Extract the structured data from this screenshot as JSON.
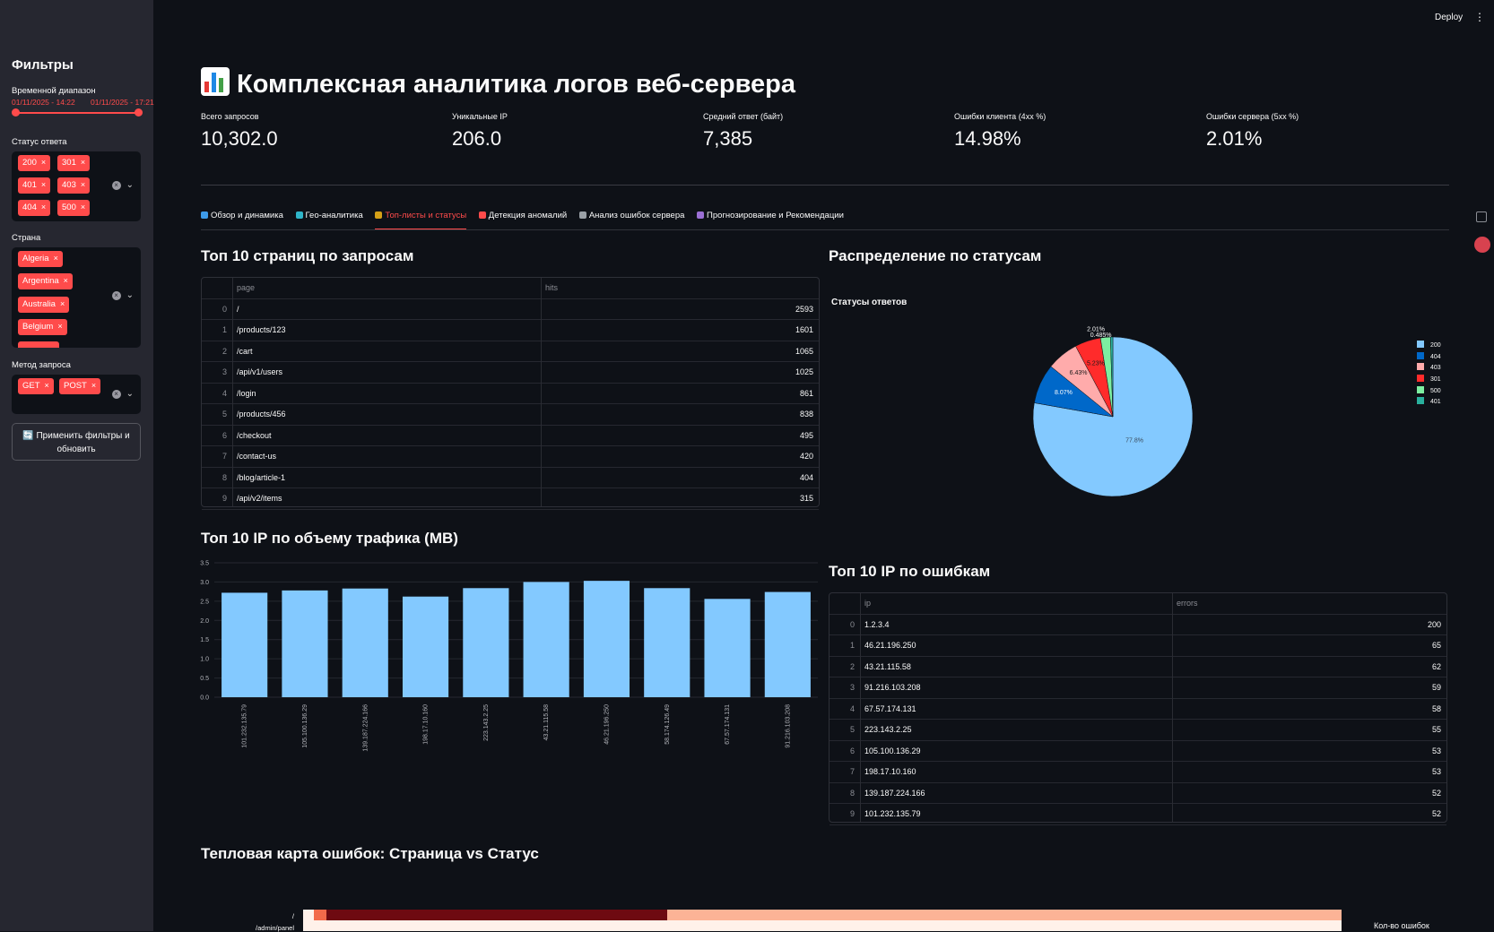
{
  "header": {
    "deploy_label": "Deploy",
    "menu_glyph": "⋮"
  },
  "sidebar": {
    "title": "Фильтры",
    "time_range": {
      "label": "Временной диапазон",
      "start": "01/11/2025 - 14:22",
      "end": "01/11/2025 - 17:21"
    },
    "status": {
      "label": "Статус ответа",
      "tags": [
        "200",
        "301",
        "401",
        "403",
        "404",
        "500"
      ]
    },
    "country": {
      "label": "Страна",
      "tags": [
        "Algeria",
        "Argentina",
        "Australia",
        "Belgium"
      ]
    },
    "method": {
      "label": "Метод запроса",
      "tags": [
        "GET",
        "POST"
      ]
    },
    "apply_button": "🔄 Применить фильтры и обновить",
    "clear_glyph": "×",
    "chevron_glyph": "⌄",
    "tag_remove_glyph": "×"
  },
  "page": {
    "title": "Комплексная аналитика логов веб-сервера",
    "title_icon": "bar-chart-icon"
  },
  "metrics": [
    {
      "label": "Всего запросов",
      "value": "10,302.0"
    },
    {
      "label": "Уникальные IP",
      "value": "206.0"
    },
    {
      "label": "Средний ответ (байт)",
      "value": "7,385"
    },
    {
      "label": "Ошибки клиента (4xx %)",
      "value": "14.98%"
    },
    {
      "label": "Ошибки сервера (5xx %)",
      "value": "2.01%"
    }
  ],
  "tabs": [
    {
      "label": "Обзор и динамика",
      "icon": "chart-increasing-icon",
      "icon_color": "#3d9be9"
    },
    {
      "label": "Гео-аналитика",
      "icon": "globe-icon",
      "icon_color": "#2fb5c9"
    },
    {
      "label": "Топ-листы и статусы",
      "icon": "traffic-light-icon",
      "icon_color": "#d4a017",
      "active": true
    },
    {
      "label": "Детекция аномалий",
      "icon": "siren-icon",
      "icon_color": "#ff4b4b"
    },
    {
      "label": "Анализ ошибок сервера",
      "icon": "wrench-icon",
      "icon_color": "#9aa0a6"
    },
    {
      "label": "Прогнозирование и Рекомендации",
      "icon": "crystal-ball-icon",
      "icon_color": "#9b6fd4"
    }
  ],
  "top_pages": {
    "heading": "Топ 10 страниц по запросам",
    "columns": [
      "page",
      "hits"
    ],
    "rows": [
      [
        "0",
        "/",
        "2593"
      ],
      [
        "1",
        "/products/123",
        "1601"
      ],
      [
        "2",
        "/cart",
        "1065"
      ],
      [
        "3",
        "/api/v1/users",
        "1025"
      ],
      [
        "4",
        "/login",
        "861"
      ],
      [
        "5",
        "/products/456",
        "838"
      ],
      [
        "6",
        "/checkout",
        "495"
      ],
      [
        "7",
        "/contact-us",
        "420"
      ],
      [
        "8",
        "/blog/article-1",
        "404"
      ],
      [
        "9",
        "/api/v2/items",
        "315"
      ]
    ]
  },
  "status_dist": {
    "heading": "Распределение по статусам",
    "chart_title": "Статусы ответов"
  },
  "top_ip_traffic": {
    "heading": "Топ 10 IP по объему трафика (MB)"
  },
  "top_ip_errors": {
    "heading": "Топ 10 IP по ошибкам",
    "columns": [
      "ip",
      "errors"
    ],
    "rows": [
      [
        "0",
        "1.2.3.4",
        "200"
      ],
      [
        "1",
        "46.21.196.250",
        "65"
      ],
      [
        "2",
        "43.21.115.58",
        "62"
      ],
      [
        "3",
        "91.216.103.208",
        "59"
      ],
      [
        "4",
        "67.57.174.131",
        "58"
      ],
      [
        "5",
        "223.143.2.25",
        "55"
      ],
      [
        "6",
        "105.100.136.29",
        "53"
      ],
      [
        "7",
        "198.17.10.160",
        "53"
      ],
      [
        "8",
        "139.187.224.166",
        "52"
      ],
      [
        "9",
        "101.232.135.79",
        "52"
      ]
    ]
  },
  "heatmap": {
    "heading": "Тепловая карта ошибок: Страница vs Статус",
    "row_labels": [
      "/",
      "/admin/panel"
    ],
    "colorbar_label": "Кол-во ошибок"
  },
  "chart_data": [
    {
      "type": "pie",
      "title": "Статусы ответов",
      "categories": [
        "200",
        "404",
        "403",
        "301",
        "500",
        "401"
      ],
      "values": [
        77.8,
        8.07,
        6.43,
        5.23,
        2.01,
        0.485
      ],
      "value_labels": [
        "77.8%",
        "8.07%",
        "6.43%",
        "5.23%",
        "2.01%",
        "0.485%"
      ],
      "colors": [
        "#83c9ff",
        "#0068c9",
        "#ffabab",
        "#ff2b2b",
        "#7defa1",
        "#29b09d"
      ],
      "legend": "right"
    },
    {
      "type": "bar",
      "categories": [
        "101.232.135.79",
        "105.100.136.29",
        "139.187.224.166",
        "198.17.10.160",
        "223.143.2.25",
        "43.21.115.58",
        "46.21.196.250",
        "58.174.126.49",
        "67.57.174.131",
        "91.216.103.208"
      ],
      "values": [
        2.72,
        2.78,
        2.83,
        2.62,
        2.84,
        3.0,
        3.03,
        2.84,
        2.56,
        2.74
      ],
      "ylim": [
        0,
        3.5
      ],
      "yticks": [
        "0.0",
        "0.5",
        "1.0",
        "1.5",
        "2.0",
        "2.5",
        "3.0",
        "3.5"
      ],
      "color": "#83c9ff",
      "grid": true
    }
  ]
}
